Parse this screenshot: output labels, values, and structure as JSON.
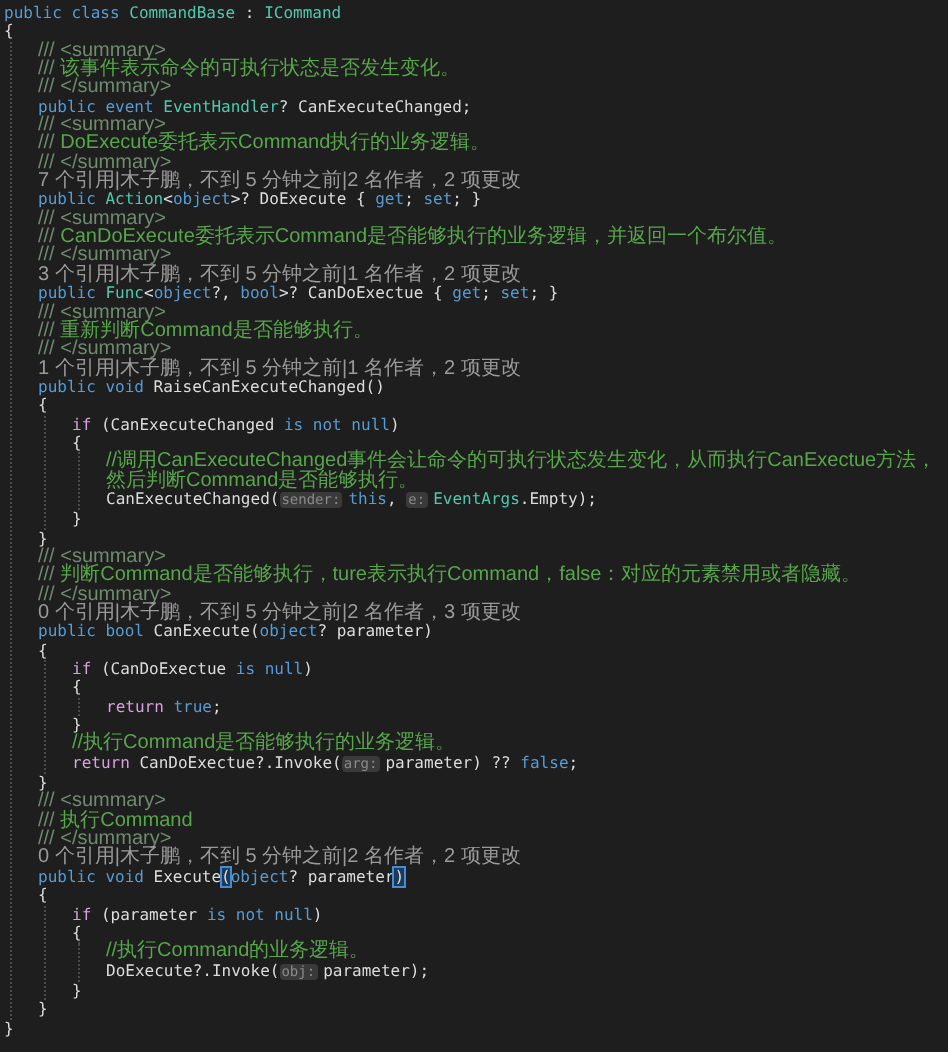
{
  "editor": {
    "lines": [
      {
        "kind": "code",
        "tokens": [
          {
            "kind": "kw",
            "text": "public class "
          },
          {
            "kind": "type",
            "text": "CommandBase"
          },
          {
            "kind": "id",
            "text": " : "
          },
          {
            "kind": "type",
            "text": "ICommand"
          }
        ]
      },
      {
        "kind": "code",
        "tokens": [
          {
            "kind": "id",
            "text": "{"
          }
        ],
        "children": [
          {
            "kind": "comment",
            "tokens": [
              {
                "kind": "doc",
                "text": "/// <summary>"
              }
            ]
          },
          {
            "kind": "comment",
            "tokens": [
              {
                "kind": "doc",
                "text": "/// "
              },
              {
                "kind": "comment",
                "text": "该事件表示命令的可执行状态是否发生变化。"
              }
            ]
          },
          {
            "kind": "comment",
            "tokens": [
              {
                "kind": "doc",
                "text": "/// </summary>"
              }
            ]
          },
          {
            "kind": "code",
            "tokens": [
              {
                "kind": "kw",
                "text": "public event "
              },
              {
                "kind": "type",
                "text": "EventHandler"
              },
              {
                "kind": "id",
                "text": "? CanExecuteChanged;"
              }
            ]
          },
          {
            "kind": "comment",
            "tokens": [
              {
                "kind": "doc",
                "text": "/// <summary>"
              }
            ]
          },
          {
            "kind": "comment",
            "tokens": [
              {
                "kind": "doc",
                "text": "/// "
              },
              {
                "kind": "comment",
                "text": "DoExecute委托表示Command执行的业务逻辑。"
              }
            ]
          },
          {
            "kind": "comment",
            "tokens": [
              {
                "kind": "doc",
                "text": "/// </summary>"
              }
            ]
          },
          {
            "kind": "lens",
            "tokens": [
              {
                "kind": "lens",
                "text": "7 个引用|木子鹏，不到 5 分钟之前|2 名作者，2 项更改"
              }
            ]
          },
          {
            "kind": "code",
            "tokens": [
              {
                "kind": "kw",
                "text": "public "
              },
              {
                "kind": "type",
                "text": "Action"
              },
              {
                "kind": "id",
                "text": "<"
              },
              {
                "kind": "kw",
                "text": "object"
              },
              {
                "kind": "id",
                "text": ">? DoExecute { "
              },
              {
                "kind": "kw",
                "text": "get"
              },
              {
                "kind": "id",
                "text": "; "
              },
              {
                "kind": "kw",
                "text": "set"
              },
              {
                "kind": "id",
                "text": "; }"
              }
            ]
          },
          {
            "kind": "comment",
            "tokens": [
              {
                "kind": "doc",
                "text": "/// <summary>"
              }
            ]
          },
          {
            "kind": "comment",
            "tokens": [
              {
                "kind": "doc",
                "text": "/// "
              },
              {
                "kind": "comment",
                "text": "CanDoExecute委托表示Command是否能够执行的业务逻辑，并返回一个布尔值。"
              }
            ]
          },
          {
            "kind": "comment",
            "tokens": [
              {
                "kind": "doc",
                "text": "/// </summary>"
              }
            ]
          },
          {
            "kind": "lens",
            "tokens": [
              {
                "kind": "lens",
                "text": "3 个引用|木子鹏，不到 5 分钟之前|1 名作者，2 项更改"
              }
            ]
          },
          {
            "kind": "code",
            "tokens": [
              {
                "kind": "kw",
                "text": "public "
              },
              {
                "kind": "type",
                "text": "Func"
              },
              {
                "kind": "id",
                "text": "<"
              },
              {
                "kind": "kw",
                "text": "object"
              },
              {
                "kind": "id",
                "text": "?, "
              },
              {
                "kind": "kw",
                "text": "bool"
              },
              {
                "kind": "id",
                "text": ">? CanDoExectue { "
              },
              {
                "kind": "kw",
                "text": "get"
              },
              {
                "kind": "id",
                "text": "; "
              },
              {
                "kind": "kw",
                "text": "set"
              },
              {
                "kind": "id",
                "text": "; }"
              }
            ]
          },
          {
            "kind": "comment",
            "tokens": [
              {
                "kind": "doc",
                "text": "/// <summary>"
              }
            ]
          },
          {
            "kind": "comment",
            "tokens": [
              {
                "kind": "doc",
                "text": "/// "
              },
              {
                "kind": "comment",
                "text": "重新判断Command是否能够执行。"
              }
            ]
          },
          {
            "kind": "comment",
            "tokens": [
              {
                "kind": "doc",
                "text": "/// </summary>"
              }
            ]
          },
          {
            "kind": "lens",
            "tokens": [
              {
                "kind": "lens",
                "text": "1 个引用|木子鹏，不到 5 分钟之前|1 名作者，2 项更改"
              }
            ]
          },
          {
            "kind": "code",
            "tokens": [
              {
                "kind": "kw",
                "text": "public void "
              },
              {
                "kind": "id",
                "text": "RaiseCanExecuteChanged()"
              }
            ]
          },
          {
            "kind": "code",
            "tokens": [
              {
                "kind": "id",
                "text": "{"
              }
            ],
            "children": [
              {
                "kind": "code",
                "tokens": [
                  {
                    "kind": "ctl",
                    "text": "if"
                  },
                  {
                    "kind": "id",
                    "text": " (CanExecuteChanged "
                  },
                  {
                    "kind": "kw",
                    "text": "is not null"
                  },
                  {
                    "kind": "id",
                    "text": ")"
                  }
                ]
              },
              {
                "kind": "code",
                "tokens": [
                  {
                    "kind": "id",
                    "text": "{"
                  }
                ],
                "children": [
                  {
                    "kind": "comment",
                    "tokens": [
                      {
                        "kind": "comment",
                        "text": "//调用CanExecuteChanged事件会让命令的可执行状态发生变化，从而执行CanExectue方法，然后判断Command是否能够执行。"
                      }
                    ]
                  },
                  {
                    "kind": "code",
                    "tokens": [
                      {
                        "kind": "id",
                        "text": "CanExecuteChanged("
                      },
                      {
                        "kind": "hint",
                        "text": "sender:"
                      },
                      {
                        "kind": "kw",
                        "text": "this"
                      },
                      {
                        "kind": "id",
                        "text": ", "
                      },
                      {
                        "kind": "hint",
                        "text": "e:"
                      },
                      {
                        "kind": "type",
                        "text": "EventArgs"
                      },
                      {
                        "kind": "id",
                        "text": ".Empty);"
                      }
                    ]
                  }
                ]
              },
              {
                "kind": "code",
                "tokens": [
                  {
                    "kind": "id",
                    "text": "}"
                  }
                ]
              }
            ]
          },
          {
            "kind": "code",
            "tokens": [
              {
                "kind": "id",
                "text": "}"
              }
            ]
          },
          {
            "kind": "comment",
            "tokens": [
              {
                "kind": "doc",
                "text": "/// <summary>"
              }
            ]
          },
          {
            "kind": "comment",
            "tokens": [
              {
                "kind": "doc",
                "text": "/// "
              },
              {
                "kind": "comment",
                "text": "判断Command是否能够执行，ture表示执行Command，false：对应的元素禁用或者隐藏。"
              }
            ]
          },
          {
            "kind": "comment",
            "tokens": [
              {
                "kind": "doc",
                "text": "/// </summary>"
              }
            ]
          },
          {
            "kind": "lens",
            "tokens": [
              {
                "kind": "lens",
                "text": "0 个引用|木子鹏，不到 5 分钟之前|2 名作者，3 项更改"
              }
            ]
          },
          {
            "kind": "code",
            "tokens": [
              {
                "kind": "kw",
                "text": "public bool "
              },
              {
                "kind": "id",
                "text": "CanExecute("
              },
              {
                "kind": "kw",
                "text": "object"
              },
              {
                "kind": "id",
                "text": "? parameter)"
              }
            ]
          },
          {
            "kind": "code",
            "tokens": [
              {
                "kind": "id",
                "text": "{"
              }
            ],
            "children": [
              {
                "kind": "code",
                "tokens": [
                  {
                    "kind": "ctl",
                    "text": "if"
                  },
                  {
                    "kind": "id",
                    "text": " (CanDoExectue "
                  },
                  {
                    "kind": "kw",
                    "text": "is null"
                  },
                  {
                    "kind": "id",
                    "text": ")"
                  }
                ]
              },
              {
                "kind": "code",
                "tokens": [
                  {
                    "kind": "id",
                    "text": "{"
                  }
                ],
                "children": [
                  {
                    "kind": "code",
                    "tokens": [
                      {
                        "kind": "ctl",
                        "text": "return "
                      },
                      {
                        "kind": "kw",
                        "text": "true"
                      },
                      {
                        "kind": "id",
                        "text": ";"
                      }
                    ]
                  }
                ]
              },
              {
                "kind": "code",
                "tokens": [
                  {
                    "kind": "id",
                    "text": "}"
                  }
                ]
              },
              {
                "kind": "comment",
                "tokens": [
                  {
                    "kind": "comment",
                    "text": "//执行Command是否能够执行的业务逻辑。"
                  }
                ]
              },
              {
                "kind": "code",
                "tokens": [
                  {
                    "kind": "ctl",
                    "text": "return "
                  },
                  {
                    "kind": "id",
                    "text": "CanDoExectue?.Invoke("
                  },
                  {
                    "kind": "hint",
                    "text": "arg:"
                  },
                  {
                    "kind": "id",
                    "text": "parameter) ?? "
                  },
                  {
                    "kind": "kw",
                    "text": "false"
                  },
                  {
                    "kind": "id",
                    "text": ";"
                  }
                ]
              }
            ]
          },
          {
            "kind": "code",
            "tokens": [
              {
                "kind": "id",
                "text": "}"
              }
            ]
          },
          {
            "kind": "comment",
            "tokens": [
              {
                "kind": "doc",
                "text": "/// <summary>"
              }
            ]
          },
          {
            "kind": "comment",
            "tokens": [
              {
                "kind": "doc",
                "text": "/// "
              },
              {
                "kind": "comment",
                "text": "执行Command"
              }
            ]
          },
          {
            "kind": "comment",
            "tokens": [
              {
                "kind": "doc",
                "text": "/// </summary>"
              }
            ]
          },
          {
            "kind": "lens",
            "tokens": [
              {
                "kind": "lens",
                "text": "0 个引用|木子鹏，不到 5 分钟之前|2 名作者，2 项更改"
              }
            ]
          },
          {
            "kind": "code",
            "tokens": [
              {
                "kind": "kw",
                "text": "public void "
              },
              {
                "kind": "id",
                "text": "Execute"
              },
              {
                "kind": "match",
                "text": "("
              },
              {
                "kind": "kw",
                "text": "object"
              },
              {
                "kind": "id",
                "text": "? parameter"
              },
              {
                "kind": "match",
                "text": ")"
              }
            ]
          },
          {
            "kind": "code",
            "tokens": [
              {
                "kind": "id",
                "text": "{"
              }
            ],
            "children": [
              {
                "kind": "code",
                "tokens": [
                  {
                    "kind": "ctl",
                    "text": "if"
                  },
                  {
                    "kind": "id",
                    "text": " (parameter "
                  },
                  {
                    "kind": "kw",
                    "text": "is not null"
                  },
                  {
                    "kind": "id",
                    "text": ")"
                  }
                ]
              },
              {
                "kind": "code",
                "tokens": [
                  {
                    "kind": "id",
                    "text": "{"
                  }
                ],
                "children": [
                  {
                    "kind": "comment",
                    "tokens": [
                      {
                        "kind": "comment",
                        "text": "//执行Command的业务逻辑。"
                      }
                    ]
                  },
                  {
                    "kind": "code",
                    "tokens": [
                      {
                        "kind": "id",
                        "text": "DoExecute?.Invoke("
                      },
                      {
                        "kind": "hint",
                        "text": "obj:"
                      },
                      {
                        "kind": "id",
                        "text": "parameter);"
                      }
                    ]
                  }
                ]
              },
              {
                "kind": "code",
                "tokens": [
                  {
                    "kind": "id",
                    "text": "}"
                  }
                ]
              }
            ]
          },
          {
            "kind": "code",
            "tokens": [
              {
                "kind": "id",
                "text": "}"
              }
            ]
          }
        ]
      },
      {
        "kind": "code",
        "tokens": [
          {
            "kind": "id",
            "text": "}"
          }
        ]
      }
    ]
  }
}
